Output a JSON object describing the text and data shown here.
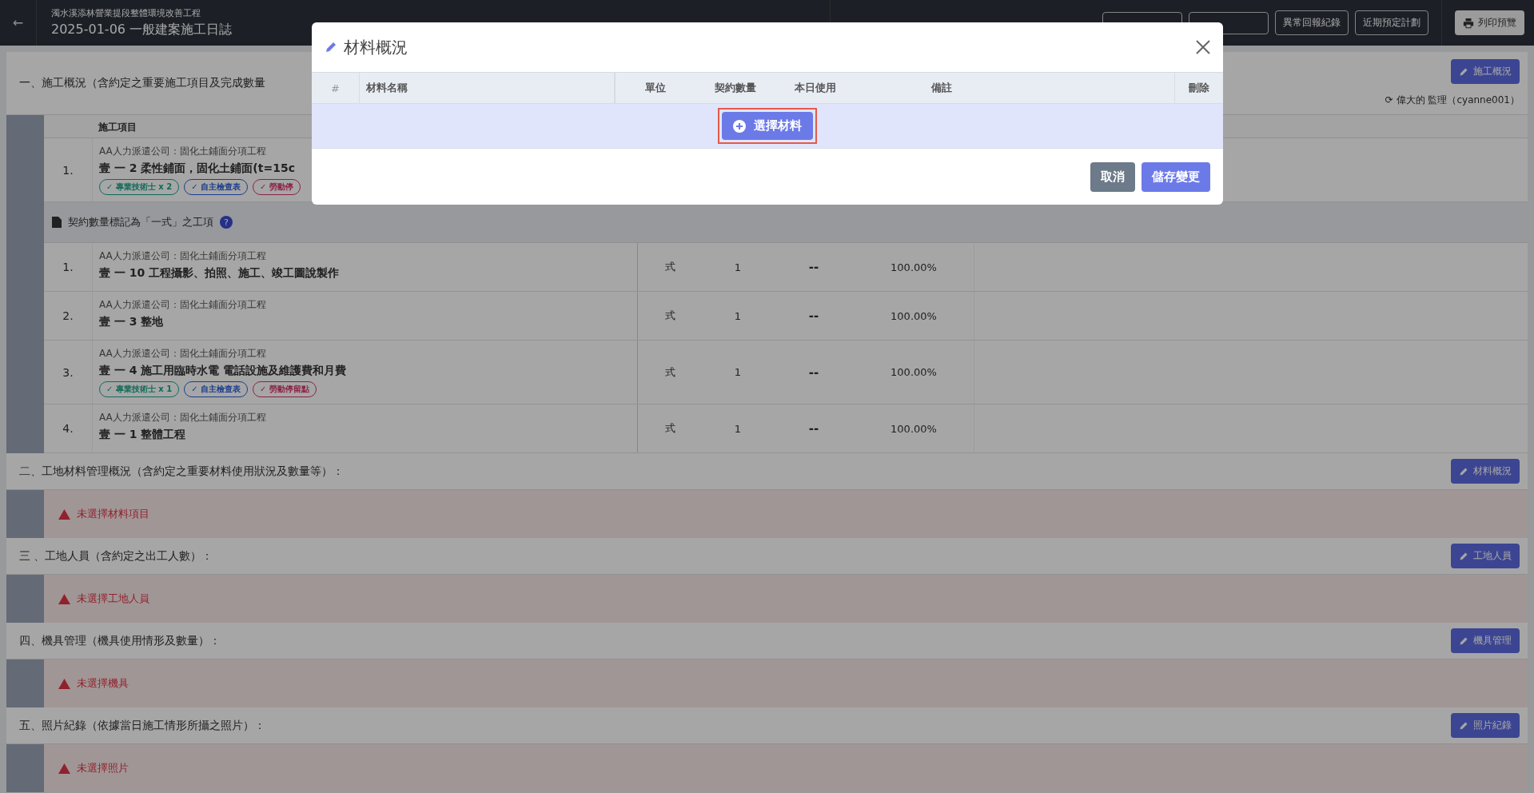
{
  "topbar": {
    "back_icon": "←",
    "project": "濁水溪添林營業提段整體環境改善工程",
    "title": "2025-01-06 一般建案施工日誌",
    "record_buttons": [
      "異常回報紀錄",
      "近期預定計劃"
    ],
    "print_button": "列印預覽"
  },
  "section_one": {
    "title": "一、施工概況（含約定之重要施工項目及完成數量",
    "edit_button": "施工概況",
    "signer": "⟳ 偉大的 監理（cyanne001）",
    "column": "施工項目",
    "rows": [
      {
        "index": "1.",
        "company": "AA人力派遣公司：固化土鋪面分項工程",
        "item": "壹 一 2 柔性鋪面，固化土鋪面(t=15c",
        "tags": [
          {
            "text": "✓ 專業技術士 x 2",
            "color": "#0f6b59"
          },
          {
            "text": "✓ 自主檢查表",
            "color": "#1c3e8d"
          },
          {
            "text": "✓ 勞動停",
            "color": "#8b2146"
          }
        ]
      }
    ],
    "lump_sum_heading": "契約數量標記為「一式」之工項",
    "help_icon": "?",
    "lump_sum_rows": [
      {
        "index": "1.",
        "company": "AA人力派遣公司：固化土鋪面分項工程",
        "item": "壹 一 10 工程攝影、拍照、施工、竣工圖說製作",
        "unit": "式",
        "contract": "1",
        "today": "--",
        "percent": "100.00%",
        "tags": []
      },
      {
        "index": "2.",
        "company": "AA人力派遣公司：固化土鋪面分項工程",
        "item": "壹 一 3 整地",
        "unit": "式",
        "contract": "1",
        "today": "--",
        "percent": "100.00%",
        "tags": []
      },
      {
        "index": "3.",
        "company": "AA人力派遣公司：固化土鋪面分項工程",
        "item": "壹 一 4 施工用臨時水電 電話設施及維護費和月費",
        "unit": "式",
        "contract": "1",
        "today": "--",
        "percent": "100.00%",
        "tags": [
          {
            "text": "✓ 專業技術士 x 1",
            "color": "#0f6b59"
          },
          {
            "text": "✓ 自主檢查表",
            "color": "#1c3e8d"
          },
          {
            "text": "✓ 勞動停留點",
            "color": "#8b2146"
          }
        ]
      },
      {
        "index": "4.",
        "company": "AA人力派遣公司：固化土鋪面分項工程",
        "item": "壹 一 1 整體工程",
        "unit": "式",
        "contract": "1",
        "today": "--",
        "percent": "100.00%",
        "tags": []
      }
    ]
  },
  "sections": [
    {
      "title": "二、工地材料管理概況（含約定之重要材料使用狀況及數量等）：",
      "edit_button": "材料概況",
      "warning": "未選擇材料項目"
    },
    {
      "title": "三 、工地人員（含約定之出工人數）：",
      "edit_button": "工地人員",
      "warning": "未選擇工地人員"
    },
    {
      "title": "四、機具管理（機具使用情形及數量）：",
      "edit_button": "機具管理",
      "warning": "未選擇機具"
    },
    {
      "title": "五、照片紀錄（依據當日施工情形所攝之照片）：",
      "edit_button": "照片紀錄",
      "warning": "未選擇照片"
    }
  ],
  "modal": {
    "title": "材料概況",
    "columns": [
      "#",
      "材料名稱",
      "單位",
      "契約數量",
      "本日使用",
      "備註",
      "刪除"
    ],
    "select_button": "選擇材料",
    "highlighted": true,
    "cancel_button": "取消",
    "save_button": "儲存變更"
  }
}
